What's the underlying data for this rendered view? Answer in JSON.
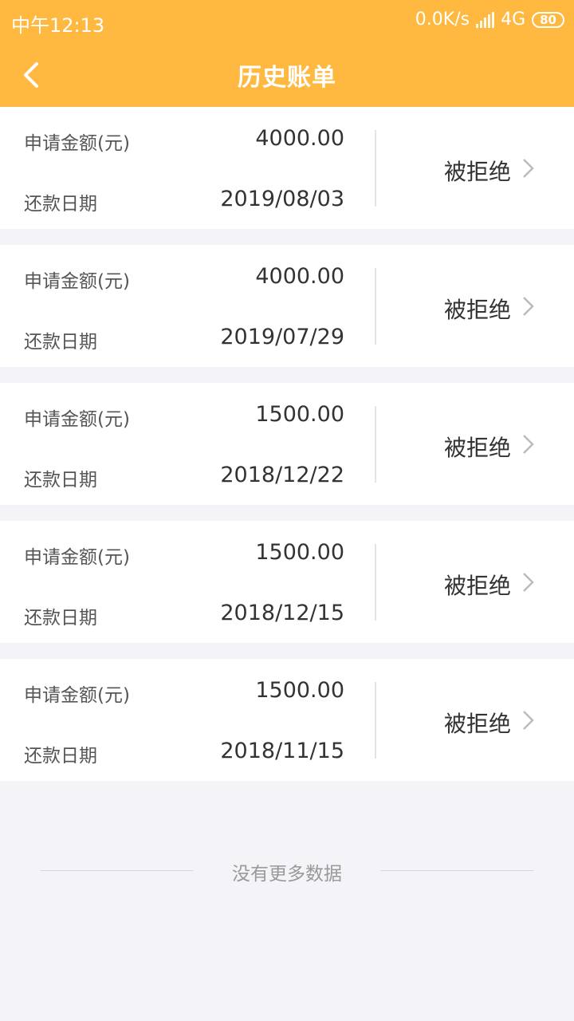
{
  "status_bar": {
    "time": "中午12:13",
    "network": "0.0K/s",
    "net_type": "4G",
    "battery": "80"
  },
  "header": {
    "title": "历史账单",
    "back_icon": "chevron-left-icon"
  },
  "bills": [
    {
      "amount_label": "申请金额(元)",
      "amount": "4000.00",
      "date_label": "还款日期",
      "date": "2019/08/03",
      "status": "被拒绝"
    },
    {
      "amount_label": "申请金额(元)",
      "amount": "4000.00",
      "date_label": "还款日期",
      "date": "2019/07/29",
      "status": "被拒绝"
    },
    {
      "amount_label": "申请金额(元)",
      "amount": "1500.00",
      "date_label": "还款日期",
      "date": "2018/12/22",
      "status": "被拒绝"
    },
    {
      "amount_label": "申请金额(元)",
      "amount": "1500.00",
      "date_label": "还款日期",
      "date": "2018/12/15",
      "status": "被拒绝"
    },
    {
      "amount_label": "申请金额(元)",
      "amount": "1500.00",
      "date_label": "还款日期",
      "date": "2018/11/15",
      "status": "被拒绝"
    }
  ],
  "footer": {
    "no_more_text": "没有更多数据"
  },
  "colors": {
    "accent": "#ffb840",
    "background": "#f4f4f8"
  }
}
